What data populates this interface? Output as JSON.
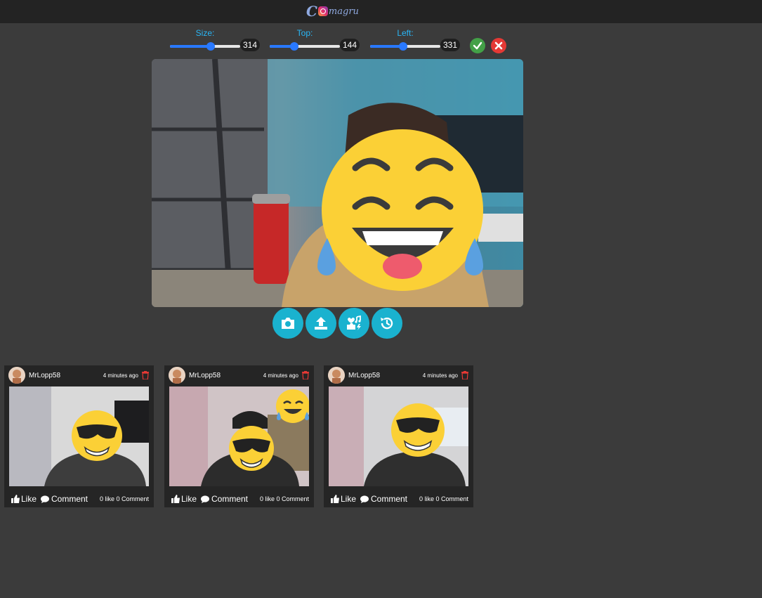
{
  "header": {
    "logo_text": "magru"
  },
  "controls": {
    "size": {
      "label": "Size:",
      "value": "314",
      "level": 0.58
    },
    "top": {
      "label": "Top:",
      "value": "144",
      "level": 0.35
    },
    "left": {
      "label": "Left:",
      "value": "331",
      "level": 0.47
    },
    "confirm_icon": "checkmark-icon",
    "cancel_icon": "close-icon"
  },
  "camera": {
    "overlay": "laughing-tears-emoji"
  },
  "toolbar": {
    "icons": [
      "camera-icon",
      "upload-icon",
      "sticker-icon",
      "history-icon"
    ]
  },
  "posts": [
    {
      "user": "MrLopp58",
      "time": "4 minutes ago",
      "like": "Like",
      "comment": "Comment",
      "stats": "0 like 0 Comment"
    },
    {
      "user": "MrLopp58",
      "time": "4 minutes ago",
      "like": "Like",
      "comment": "Comment",
      "stats": "0 like 0 Comment"
    },
    {
      "user": "MrLopp58",
      "time": "4 minutes ago",
      "like": "Like",
      "comment": "Comment",
      "stats": "0 like 0 Comment"
    }
  ],
  "colors": {
    "accent": "#1ab2cf",
    "slider": "#2979ff",
    "confirm": "#43a047",
    "cancel": "#e53935",
    "label": "#29b6f6"
  }
}
